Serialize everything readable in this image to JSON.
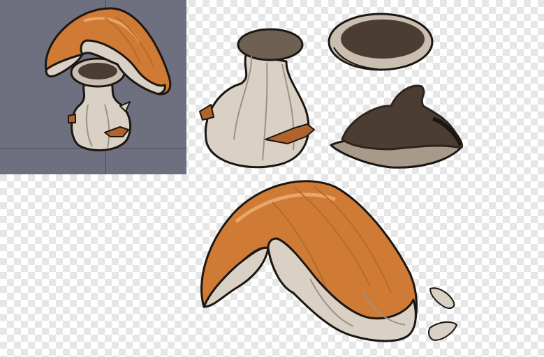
{
  "canvas": {
    "background": "transparency-checkerboard",
    "checker_colors": [
      "#ffffff",
      "#e6e6e6"
    ]
  },
  "preview_panel": {
    "background_color": "#6e7080",
    "guide_color": "#4a4c58",
    "content": "assembled-mushroom-character"
  },
  "sprite_parts": [
    {
      "name": "bulb-body",
      "colors": [
        "#d8d0c4",
        "#6e6052"
      ]
    },
    {
      "name": "cap-ring",
      "colors": [
        "#c9beb0",
        "#4a3a30"
      ]
    },
    {
      "name": "cap-underside",
      "colors": [
        "#4a3a30",
        "#a89a8a"
      ]
    },
    {
      "name": "mushroom-cap",
      "colors": [
        "#d07a36",
        "#e8a060",
        "#d8cfc4"
      ]
    },
    {
      "name": "seed-fragments",
      "colors": [
        "#d8d0c4"
      ]
    }
  ],
  "palette": {
    "outline": "#1c1612",
    "cap_orange": "#cf7a35",
    "cap_highlight": "#eaa666",
    "cream": "#d9d1c5",
    "cream_shadow": "#9c9284",
    "dark_brown": "#4c3d33",
    "accent_leaf": "#b0642c"
  }
}
